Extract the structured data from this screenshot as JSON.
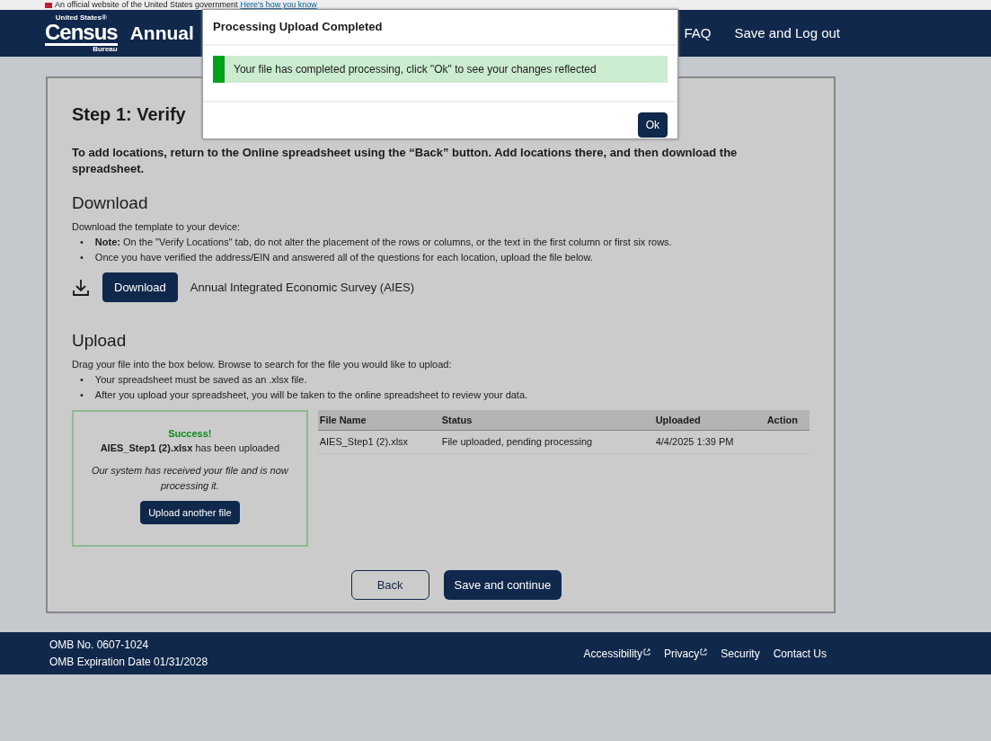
{
  "gov_banner": {
    "text": "An official website of the United States government",
    "link": "Here's how you know"
  },
  "header": {
    "logo": {
      "top": "United States®",
      "main": "Census",
      "bottom": "Bureau"
    },
    "title": "Annual",
    "nav": [
      "FAQ",
      "Save and Log out"
    ]
  },
  "step": {
    "heading": "Step 1: Verify",
    "instruction": "To add locations, return to the Online spreadsheet using the “Back” button. Add locations there, and then download the spreadsheet."
  },
  "download": {
    "heading": "Download",
    "intro": "Download the template to your device:",
    "marker": "•",
    "bullets": [
      "**Note:** On the \"Verify Locations\" tab, do not alter the placement of the rows or columns, or the text in the first column or first six rows.",
      "Once you have verified the address/EIN and answered all of the questions for each location, upload the file below."
    ],
    "button": "Download",
    "file_label": "Annual Integrated Economic Survey (AIES)"
  },
  "upload": {
    "heading": "Upload",
    "intro": "Drag your file into the box below. Browse to search for the file you would like to upload:",
    "marker": "•",
    "bullets": [
      "Your spreadsheet must be saved as an .xlsx file.",
      "After you upload your spreadsheet, you will be taken to the online spreadsheet to review your data."
    ],
    "dropzone": {
      "status": "Success!",
      "message": "**AIES_Step1 (2).xlsx** has been uploaded",
      "note": "Our system has received your file and is now processing it.",
      "button": "Upload another file"
    },
    "table": {
      "columns": [
        "File Name",
        "Status",
        "Uploaded",
        "Action"
      ],
      "rows": [
        [
          "AIES_Step1 (2).xlsx",
          "File uploaded, pending processing",
          "4/4/2025 1:39 PM",
          ""
        ]
      ]
    }
  },
  "actions": [
    "Back",
    "Save and continue"
  ],
  "footer": {
    "omb": "OMB No. 0607-1024",
    "expiration": "OMB Expiration Date 01/31/2028",
    "links": [
      {
        "label": "Accessibility",
        "external": true
      },
      {
        "label": "Privacy",
        "external": true
      },
      {
        "label": "Security",
        "external": false
      },
      {
        "label": "Contact Us",
        "external": false
      }
    ]
  },
  "modal": {
    "title": "Processing Upload Completed",
    "alert": "Your file has completed processing, click \"Ok\" to see your changes reflected",
    "button": "Ok"
  }
}
